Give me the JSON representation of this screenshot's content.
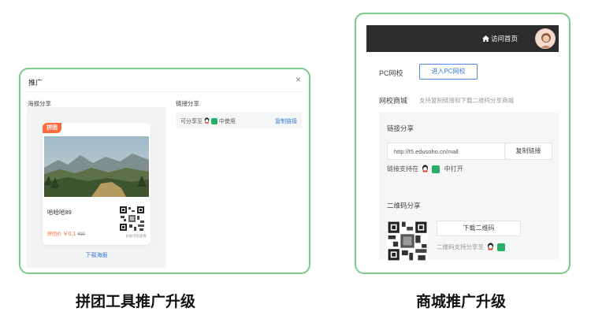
{
  "left_card": {
    "dialog_title": "推广",
    "close_glyph": "×",
    "poster_section_label": "海报分享",
    "link_section_label": "链接分享",
    "poster": {
      "badge": "拼团",
      "title": "哈哈哈89",
      "price_tag": "拼团价",
      "price": "￥0.1",
      "original_price": "¥99",
      "qr_caption": "长按识别查看"
    },
    "download_poster": "下载海报",
    "share_row": {
      "prefix": "可分享至",
      "suffix": "中使用",
      "copy_link": "复制链接"
    }
  },
  "right_card": {
    "topbar": {
      "home_icon": "home-icon",
      "home_link": "访问首页"
    },
    "pc_label": "PC网校",
    "pc_button": "进入PC网校",
    "mall_label": "网校商城",
    "mall_hint": "支持复制链接和下载二维码分享商城",
    "link_share_label": "链接分享",
    "url": "http://t5.edusoho.cn/mall",
    "copy_link_button": "复制链接",
    "link_support_prefix": "链接支持在",
    "link_support_suffix": "中打开",
    "qr_share_label": "二维码分享",
    "download_qr_button": "下载二维码",
    "qr_support_text": "二维码支持分享至"
  },
  "captions": {
    "left": "拼团工具推广升级",
    "right": "商城推广升级"
  },
  "colors": {
    "card_border": "#7cc98c",
    "accent_orange": "#ff6a3d",
    "link_blue": "#3a7bd5",
    "wechat_green": "#2aae67",
    "topbar_dark": "#2c2c2c"
  }
}
